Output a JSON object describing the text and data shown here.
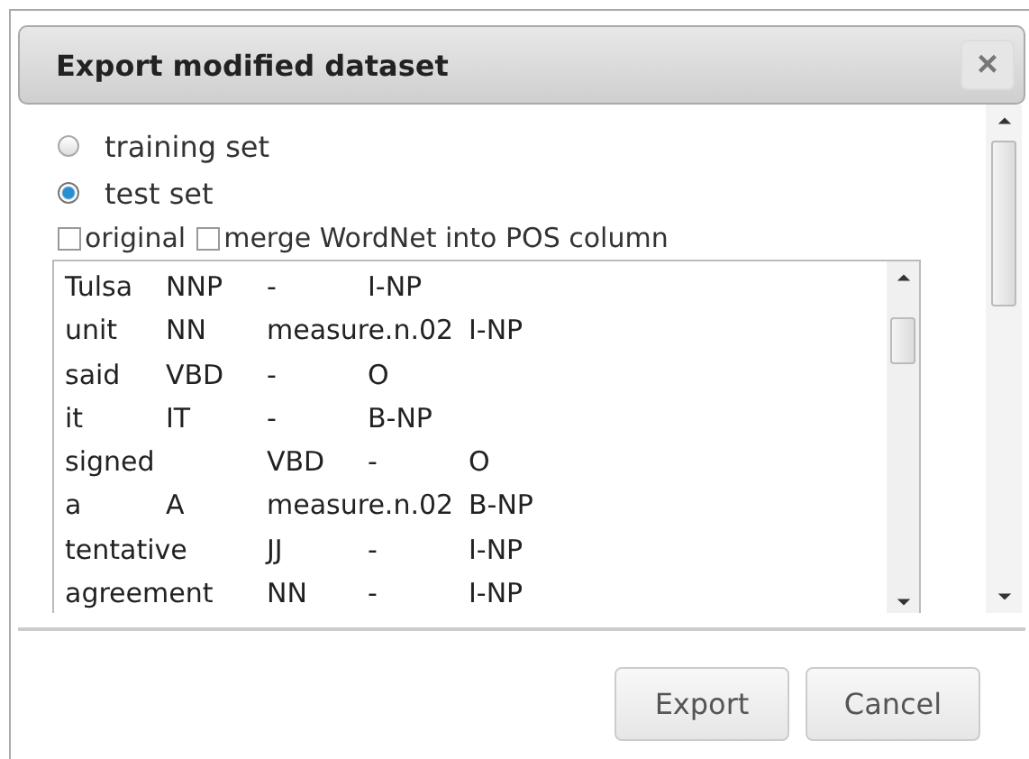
{
  "dialog": {
    "title": "Export modified dataset",
    "close_label": "×"
  },
  "sets": [
    {
      "label": "training set",
      "selected": false
    },
    {
      "label": "test set",
      "selected": true
    }
  ],
  "options": [
    {
      "label": "original",
      "checked": false
    },
    {
      "label": "merge WordNet into POS column",
      "checked": false
    }
  ],
  "output_lines": [
    "Tulsa\tNNP\t-\tI-NP",
    "unit\tNN\tmeasure.n.02\tI-NP",
    "said\tVBD\t-\tO",
    "it\tIT\t-\tB-NP",
    "signed\t\tVBD\t-\tO",
    "a\tA\tmeasure.n.02\tB-NP",
    "tentative\tJJ\t-\tI-NP",
    "agreement\tNN\t-\tI-NP"
  ],
  "buttons": [
    {
      "label": "Export"
    },
    {
      "label": "Cancel"
    }
  ]
}
